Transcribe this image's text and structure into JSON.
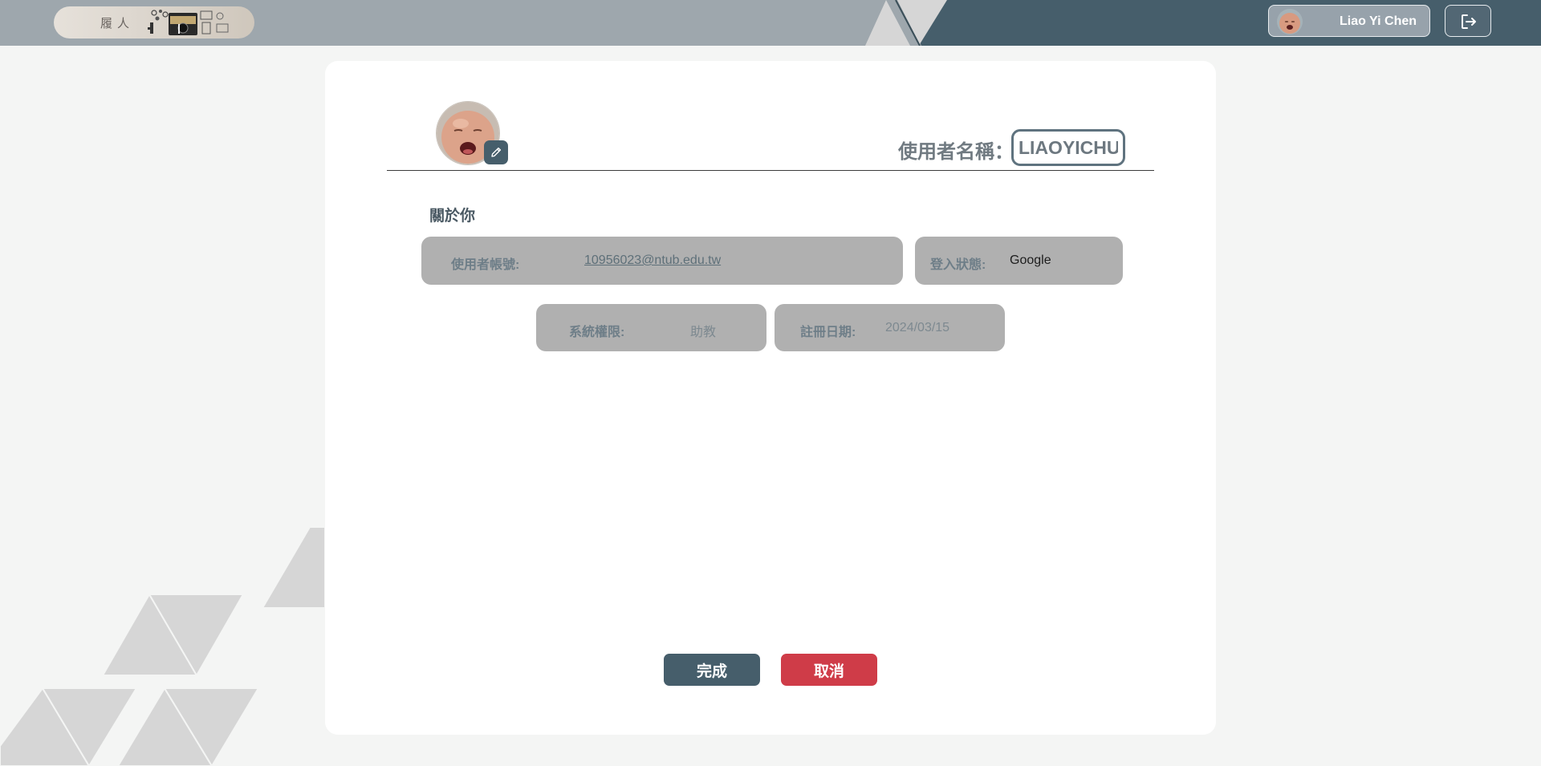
{
  "header": {
    "logo_text": "履人",
    "user_name": "Liao Yi Chen",
    "logout_icon": "logout-icon"
  },
  "profile": {
    "username_label": "使用者名稱：",
    "username_value": "LIAOYICHUN",
    "edit_icon": "pencil-icon"
  },
  "about": {
    "title": "關於你",
    "account_label": "使用者帳號:",
    "account_value": "10956023@ntub.edu.tw",
    "login_label": "登入狀態:",
    "login_value": "Google",
    "role_label": "系統權限:",
    "role_value": "助教",
    "date_label": "註冊日期:",
    "date_value": "2024/03/15"
  },
  "actions": {
    "confirm_label": "完成",
    "cancel_label": "取消"
  },
  "colors": {
    "header_light": "#9ea7ad",
    "header_dark": "#465e6b",
    "primary": "#465e6b",
    "danger": "#cf3c48",
    "field_bg": "#b0b0b0"
  }
}
